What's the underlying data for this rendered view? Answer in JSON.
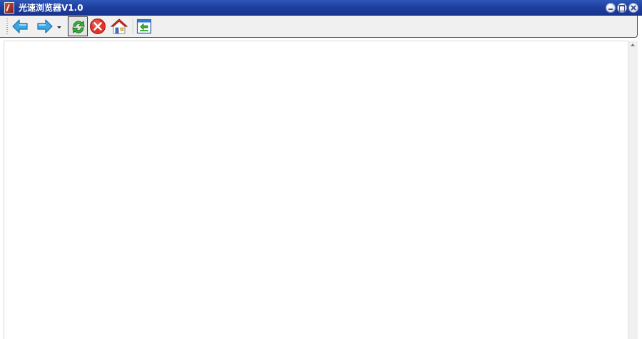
{
  "window": {
    "title": "光速浏览器V1.0",
    "colors": {
      "titlebar": "#1e3fa0",
      "toolbar": "#f0f0f0",
      "content": "#ffffff"
    },
    "controls": [
      "minimize-icon",
      "maximize-icon",
      "close-icon"
    ]
  },
  "toolbar": {
    "buttons": [
      {
        "name": "back",
        "icon": "back-arrow-icon"
      },
      {
        "name": "forward",
        "icon": "forward-arrow-icon",
        "has_dropdown": true
      },
      {
        "name": "refresh",
        "icon": "refresh-icon",
        "pressed": true
      },
      {
        "name": "stop",
        "icon": "stop-icon"
      },
      {
        "name": "home",
        "icon": "home-icon"
      },
      {
        "name": "open",
        "icon": "open-page-icon"
      }
    ]
  }
}
